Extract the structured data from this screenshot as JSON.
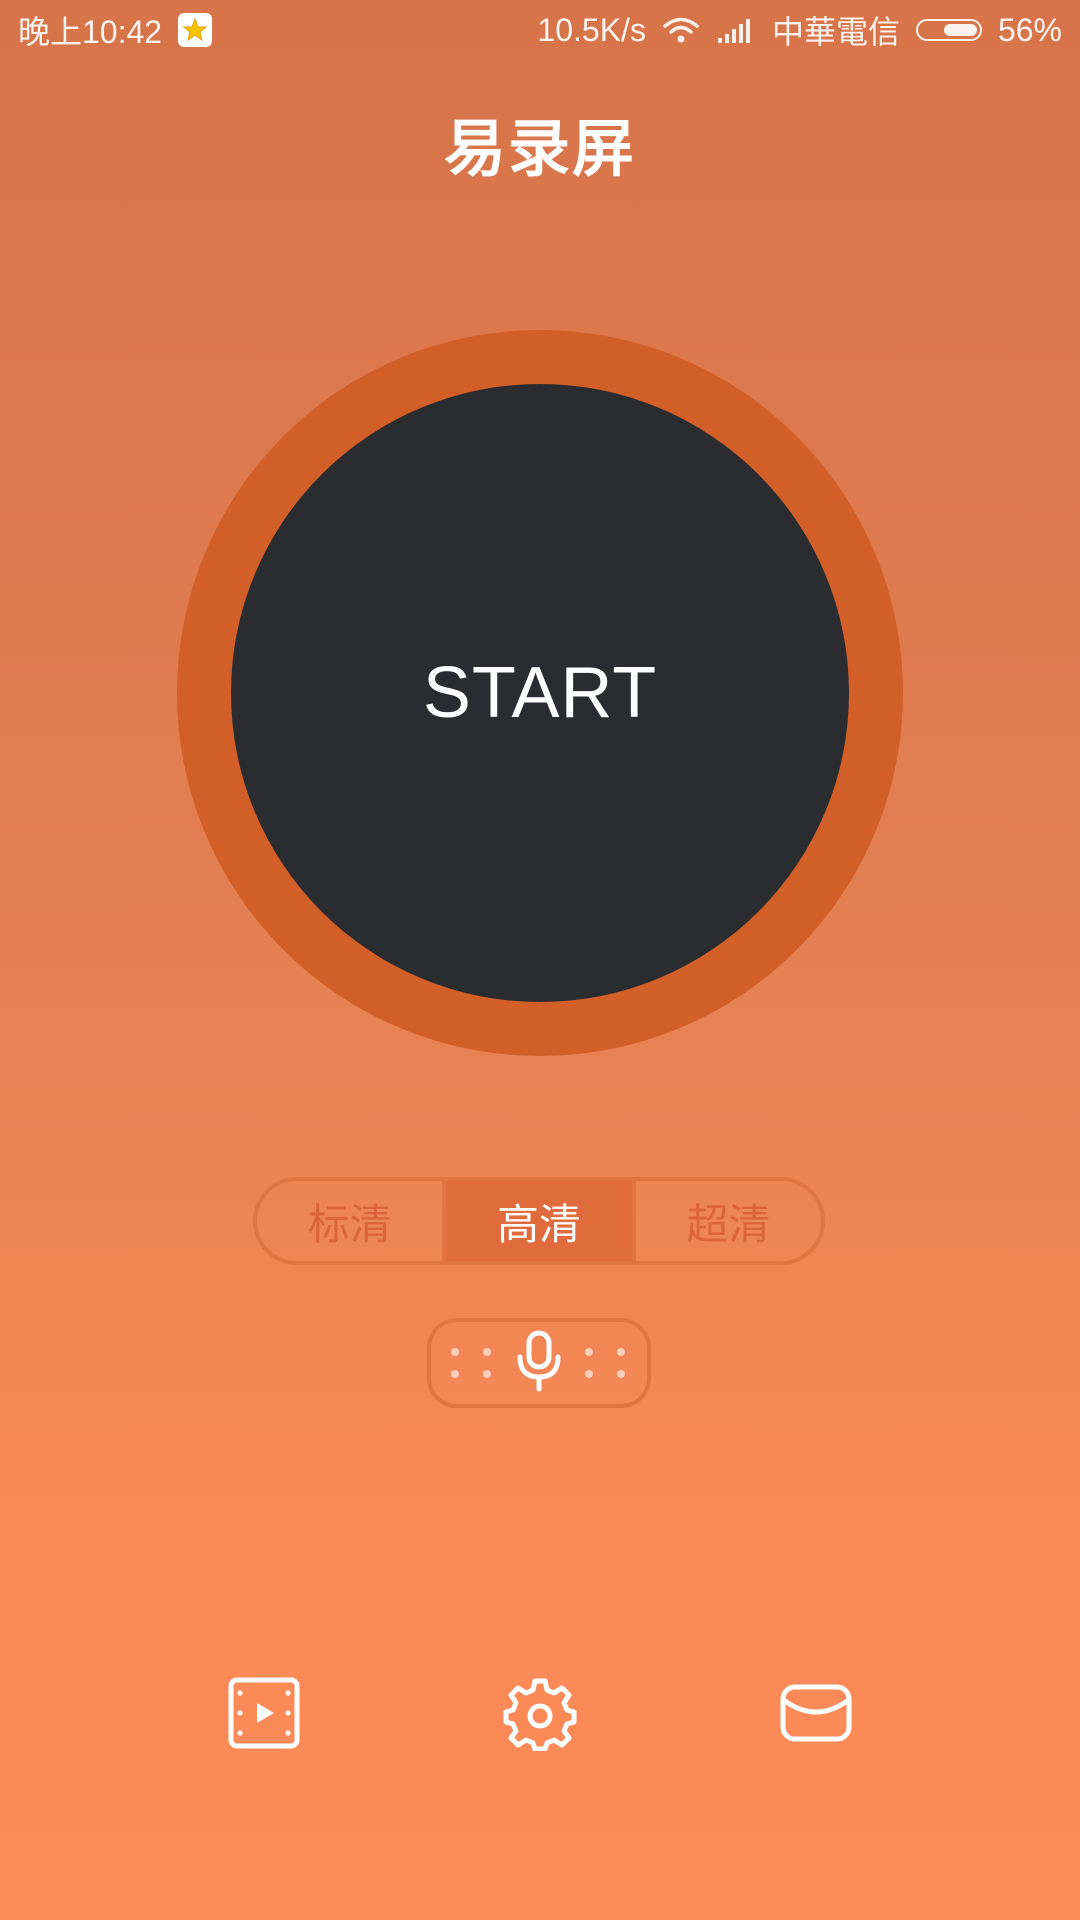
{
  "status_bar": {
    "time": "晚上10:42",
    "network_speed": "10.5K/s",
    "carrier": "中華電信",
    "battery_percent": "56%",
    "battery_level": 0.56,
    "notification_icon": "qq-icon",
    "wifi_icon": "wifi-icon",
    "signal_icon": "signal-icon"
  },
  "header": {
    "title": "易录屏"
  },
  "record": {
    "start_label": "START"
  },
  "quality": {
    "options": [
      "标清",
      "高清",
      "超清"
    ],
    "selected": "高清"
  },
  "audio": {
    "icon": "microphone-icon"
  },
  "bottom_nav": {
    "items": [
      {
        "icon": "video-library-icon"
      },
      {
        "icon": "settings-gear-icon"
      },
      {
        "icon": "mail-icon"
      }
    ]
  },
  "colors": {
    "ring": "#d25e28",
    "button": "#2b2c30",
    "accent": "#e06c3d",
    "bg_top": "#d7744a",
    "bg_bottom": "#ff8b58"
  }
}
